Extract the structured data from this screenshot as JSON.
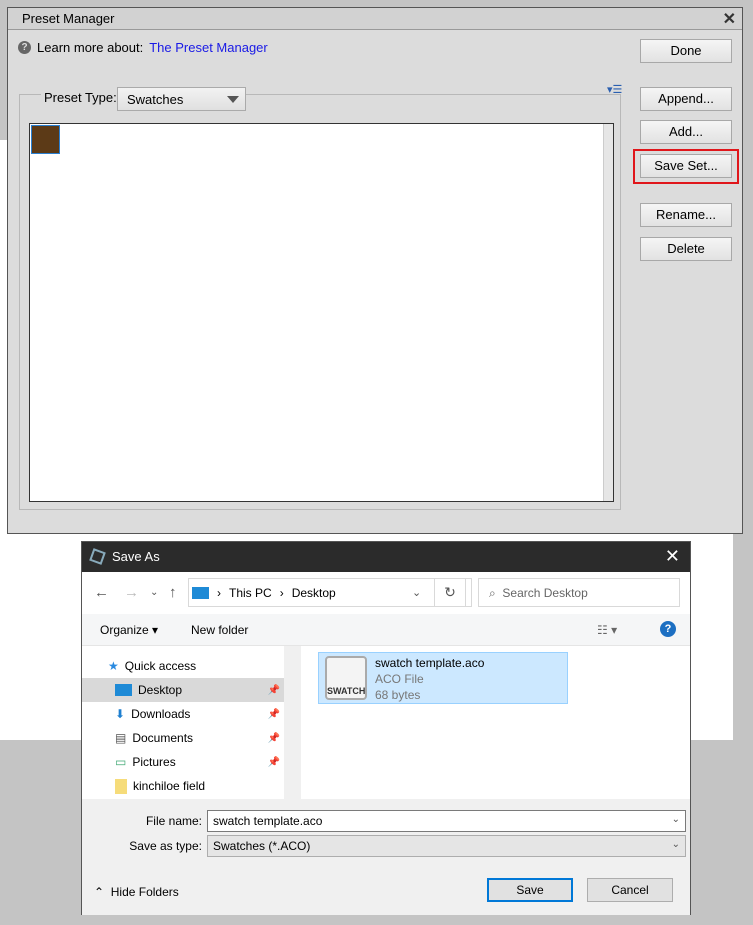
{
  "preset_manager": {
    "title": "Preset Manager",
    "learn_prefix": "Learn more about:",
    "learn_link": "The Preset Manager",
    "preset_type_label": "Preset Type:",
    "preset_type_value": "Swatches",
    "buttons": {
      "done": "Done",
      "append": "Append...",
      "add": "Add...",
      "save_set": "Save Set...",
      "rename": "Rename...",
      "delete": "Delete"
    },
    "swatch_color": "#5c3a17"
  },
  "save_as": {
    "title": "Save As",
    "breadcrumb": [
      "This PC",
      "Desktop"
    ],
    "search_placeholder": "Search Desktop",
    "organize": "Organize",
    "new_folder": "New folder",
    "tree": [
      {
        "label": "Quick access"
      },
      {
        "label": "Desktop"
      },
      {
        "label": "Downloads"
      },
      {
        "label": "Documents"
      },
      {
        "label": "Pictures"
      },
      {
        "label": "kinchiloe field"
      }
    ],
    "file": {
      "name": "swatch template.aco",
      "type": "ACO File",
      "size": "68 bytes",
      "icon_label": "SWATCH"
    },
    "file_name_label": "File name:",
    "file_name_value": "swatch template.aco",
    "save_type_label": "Save as type:",
    "save_type_value": "Swatches (*.ACO)",
    "hide_folders": "Hide Folders",
    "save": "Save",
    "cancel": "Cancel"
  }
}
